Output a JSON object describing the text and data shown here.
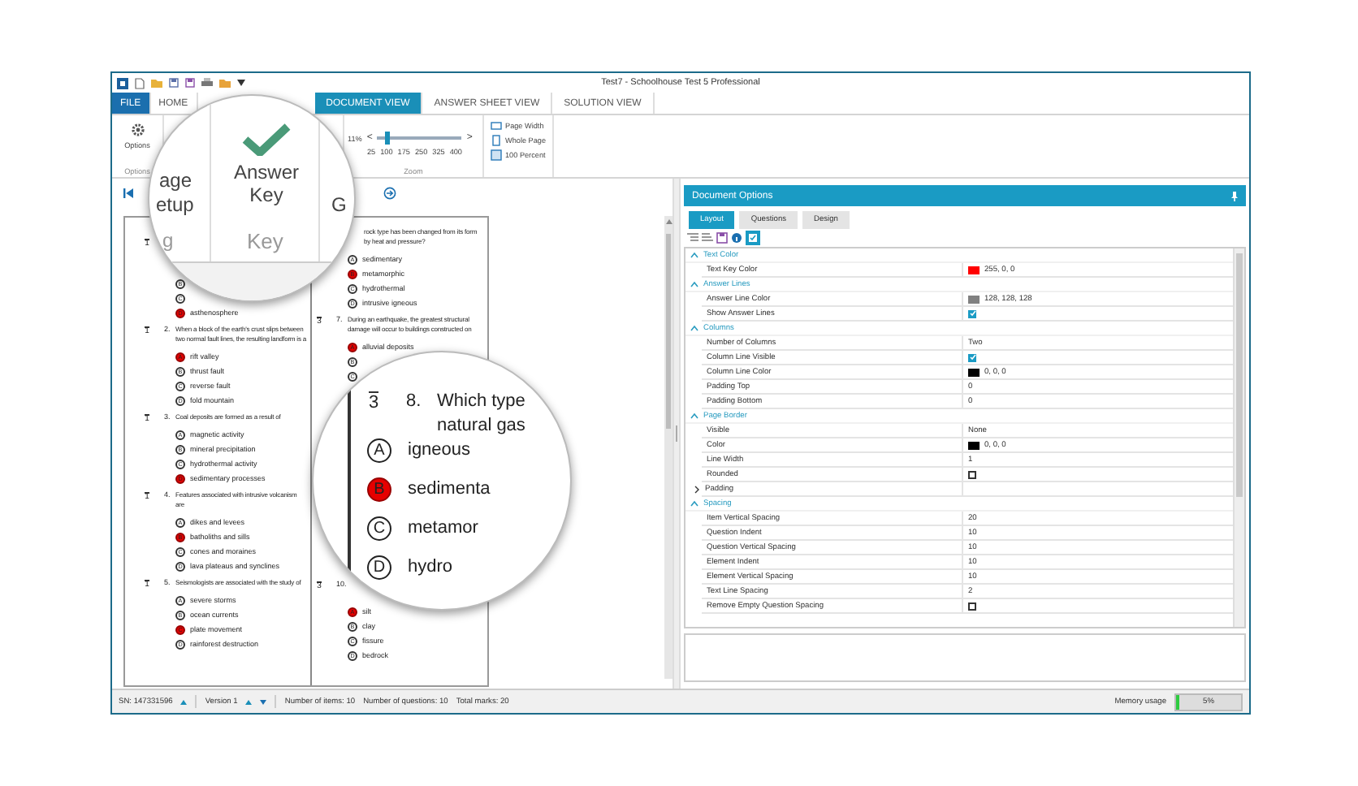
{
  "window": {
    "title": "Test7 - Schoolhouse Test 5 Professional"
  },
  "ribbon_tabs": [
    {
      "label": "FILE",
      "kind": "file",
      "selected": false
    },
    {
      "label": "HOME",
      "kind": "tab",
      "selected": false
    },
    {
      "label": "DOCUMENT VIEW",
      "kind": "tab",
      "selected": true
    },
    {
      "label": "ANSWER SHEET VIEW",
      "kind": "tab",
      "selected": false
    },
    {
      "label": "SOLUTION VIEW",
      "kind": "tab",
      "selected": false
    }
  ],
  "ribbon": {
    "options_button": "Options",
    "options_group": "Options",
    "zoom": {
      "reading": "11%",
      "out_label": "<",
      "in_label": ">",
      "level": 0.12,
      "tick_labels": [
        "25",
        "100",
        "175",
        "250",
        "325",
        "400"
      ],
      "group": "Zoom"
    },
    "view_buttons": [
      "Page Width",
      "Whole Page",
      "100 Percent"
    ]
  },
  "document": {
    "columns": [
      [
        {
          "kind": "covered_text",
          "mark": "1",
          "options": [
            {
              "letter": "B",
              "selected": false
            },
            {
              "letter": "C",
              "selected": false
            },
            {
              "letter": "D",
              "text": "asthenosphere",
              "selected": true
            }
          ]
        },
        {
          "kind": "full",
          "mark": "1",
          "number": "2.",
          "text": "When a block of the earth's crust slips between two normal fault lines, the resulting landform is a",
          "options": [
            {
              "letter": "A",
              "text": "rift valley",
              "selected": true
            },
            {
              "letter": "B",
              "text": "thrust fault",
              "selected": false
            },
            {
              "letter": "C",
              "text": "reverse fault",
              "selected": false
            },
            {
              "letter": "D",
              "text": "fold mountain",
              "selected": false
            }
          ]
        },
        {
          "kind": "full",
          "mark": "1",
          "number": "3.",
          "text": "Coal deposits are formed as a result of",
          "options": [
            {
              "letter": "A",
              "text": "magnetic activity",
              "selected": false
            },
            {
              "letter": "B",
              "text": "mineral precipitation",
              "selected": false
            },
            {
              "letter": "C",
              "text": "hydrothermal activity",
              "selected": false
            },
            {
              "letter": "D",
              "text": "sedimentary processes",
              "selected": true
            }
          ]
        },
        {
          "kind": "full",
          "mark": "1",
          "number": "4.",
          "text": "Features associated with intrusive volcanism are",
          "options": [
            {
              "letter": "A",
              "text": "dikes and levees",
              "selected": false
            },
            {
              "letter": "B",
              "text": "batholiths and sills",
              "selected": true
            },
            {
              "letter": "C",
              "text": "cones and moraines",
              "selected": false
            },
            {
              "letter": "D",
              "text": "lava plateaus and synclines",
              "selected": false
            }
          ]
        },
        {
          "kind": "full",
          "mark": "1",
          "number": "5.",
          "text": "Seismologists are associated with the study of",
          "options": [
            {
              "letter": "A",
              "text": "severe storms",
              "selected": false
            },
            {
              "letter": "B",
              "text": "ocean currents",
              "selected": false
            },
            {
              "letter": "C",
              "text": "plate movement",
              "selected": true
            },
            {
              "letter": "D",
              "text": "rainforest destruction",
              "selected": false
            }
          ]
        }
      ],
      [
        {
          "kind": "indented",
          "text": "rock type has been changed from its form by heat and pressure?",
          "options": [
            {
              "letter": "A",
              "text": "sedimentary",
              "selected": false
            },
            {
              "letter": "B",
              "text": "metamorphic",
              "selected": true
            },
            {
              "letter": "C",
              "text": "hydrothermal",
              "selected": false
            },
            {
              "letter": "D",
              "text": "intrusive igneous",
              "selected": false
            }
          ]
        },
        {
          "kind": "full",
          "mark": "3",
          "number": "7.",
          "text": "During an earthquake, the greatest structural damage will occur to buildings constructed on",
          "options": [
            {
              "letter": "A",
              "text": "alluvial deposits",
              "selected": true
            },
            {
              "letter": "B",
              "selected": false
            },
            {
              "letter": "C",
              "selected": false
            }
          ]
        },
        {
          "kind": "after_gap",
          "mark": "3",
          "number": "10.",
          "options": [
            {
              "letter": "A",
              "text": "silt",
              "selected": true
            },
            {
              "letter": "B",
              "text": "clay",
              "selected": false
            },
            {
              "letter": "C",
              "text": "fissure",
              "selected": false
            },
            {
              "letter": "D",
              "text": "bedrock",
              "selected": false
            }
          ]
        }
      ]
    ]
  },
  "document_options": {
    "title": "Document Options",
    "tabs": [
      {
        "label": "Layout",
        "selected": true
      },
      {
        "label": "Questions",
        "selected": false
      },
      {
        "label": "Design",
        "selected": false
      }
    ],
    "categories": [
      {
        "name": "Text Color",
        "expanded": true,
        "rows": [
          {
            "name": "Text Key Color",
            "kind": "color",
            "color": "#ff0000",
            "value": "255, 0, 0"
          }
        ]
      },
      {
        "name": "Answer Lines",
        "expanded": true,
        "rows": [
          {
            "name": "Answer Line Color",
            "kind": "color",
            "color": "#808080",
            "value": "128, 128, 128"
          },
          {
            "name": "Show Answer Lines",
            "kind": "checkbox",
            "checked": true
          }
        ]
      },
      {
        "name": "Columns",
        "expanded": true,
        "rows": [
          {
            "name": "Number of Columns",
            "kind": "text",
            "value": "Two"
          },
          {
            "name": "Column Line Visible",
            "kind": "checkbox",
            "checked": true
          },
          {
            "name": "Column Line Color",
            "kind": "color",
            "color": "#000000",
            "value": "0, 0, 0"
          },
          {
            "name": "Padding Top",
            "kind": "text",
            "value": "0"
          },
          {
            "name": "Padding Bottom",
            "kind": "text",
            "value": "0"
          }
        ]
      },
      {
        "name": "Page Border",
        "expanded": true,
        "rows": [
          {
            "name": "Visible",
            "kind": "text",
            "value": "None"
          },
          {
            "name": "Color",
            "kind": "color",
            "color": "#000000",
            "value": "0, 0, 0"
          },
          {
            "name": "Line Width",
            "kind": "text",
            "value": "1"
          },
          {
            "name": "Rounded",
            "kind": "checkbox",
            "checked": false
          },
          {
            "name": "Padding",
            "kind": "expandable",
            "expanded": false
          }
        ]
      },
      {
        "name": "Spacing",
        "expanded": true,
        "rows": [
          {
            "name": "Item Vertical Spacing",
            "kind": "text",
            "value": "20"
          },
          {
            "name": "Question Indent",
            "kind": "text",
            "value": "10"
          },
          {
            "name": "Question Vertical Spacing",
            "kind": "text",
            "value": "10"
          },
          {
            "name": "Element Indent",
            "kind": "text",
            "value": "10"
          },
          {
            "name": "Element Vertical Spacing",
            "kind": "text",
            "value": "10"
          },
          {
            "name": "Text Line Spacing",
            "kind": "text",
            "value": "2"
          },
          {
            "name": "Remove Empty Question Spacing",
            "kind": "checkbox",
            "checked": false
          }
        ]
      }
    ]
  },
  "status_bar": {
    "serial": "SN: 147331596",
    "version": "Version 1",
    "counts": [
      "Number of items: 10",
      "Number of questions: 10",
      "Total marks: 20"
    ],
    "memory_label": "Memory usage",
    "memory": {
      "level": 0.05,
      "reading": "5%"
    }
  },
  "ribbon_magnifier": {
    "page_setup_parts": [
      "age",
      "etup"
    ],
    "printing_part": "g",
    "answer_key": "Answer Key",
    "group_label": "Key",
    "next_part": "G"
  },
  "document_magnifier": {
    "mark": "3",
    "number": "8.",
    "text_lines": [
      "Which type",
      "natural gas"
    ],
    "options": [
      {
        "letter": "A",
        "text": "igneous",
        "selected": false
      },
      {
        "letter": "B",
        "text": "sedimenta",
        "selected": true
      },
      {
        "letter": "C",
        "text": "metamor",
        "selected": false
      },
      {
        "letter": "D",
        "text": "hydro",
        "selected": false
      }
    ]
  }
}
